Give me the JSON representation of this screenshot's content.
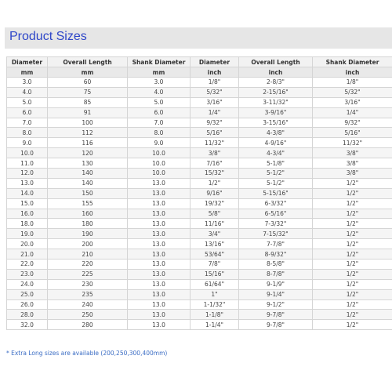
{
  "page": {
    "title": "Product Sizes"
  },
  "table": {
    "headers": [
      "Diameter",
      "Overall Length",
      "Shank Diameter",
      "Diameter",
      "Overall Length",
      "Shank Diameter"
    ],
    "units": [
      "mm",
      "mm",
      "mm",
      "inch",
      "inch",
      "inch"
    ],
    "rows": [
      [
        "3.0",
        "60",
        "3.0",
        "1/8\"",
        "2-8/3\"",
        "1/8\""
      ],
      [
        "4.0",
        "75",
        "4.0",
        "5/32\"",
        "2-15/16\"",
        "5/32\""
      ],
      [
        "5.0",
        "85",
        "5.0",
        "3/16\"",
        "3-11/32\"",
        "3/16\""
      ],
      [
        "6.0",
        "91",
        "6.0",
        "1/4\"",
        "3-9/16\"",
        "1/4\""
      ],
      [
        "7.0",
        "100",
        "7.0",
        "9/32\"",
        "3-15/16\"",
        "9/32\""
      ],
      [
        "8.0",
        "112",
        "8.0",
        "5/16\"",
        "4-3/8\"",
        "5/16\""
      ],
      [
        "9.0",
        "116",
        "9.0",
        "11/32\"",
        "4-9/16\"",
        "11/32\""
      ],
      [
        "10.0",
        "120",
        "10.0",
        "3/8\"",
        "4-3/4\"",
        "3/8\""
      ],
      [
        "11.0",
        "130",
        "10.0",
        "7/16\"",
        "5-1/8\"",
        "3/8\""
      ],
      [
        "12.0",
        "140",
        "10.0",
        "15/32\"",
        "5-1/2\"",
        "3/8\""
      ],
      [
        "13.0",
        "140",
        "13.0",
        "1/2\"",
        "5-1/2\"",
        "1/2\""
      ],
      [
        "14.0",
        "150",
        "13.0",
        "9/16\"",
        "5-15/16\"",
        "1/2\""
      ],
      [
        "15.0",
        "155",
        "13.0",
        "19/32\"",
        "6-3/32\"",
        "1/2\""
      ],
      [
        "16.0",
        "160",
        "13.0",
        "5/8\"",
        "6-5/16\"",
        "1/2\""
      ],
      [
        "18.0",
        "180",
        "13.0",
        "11/16\"",
        "7-3/32\"",
        "1/2\""
      ],
      [
        "19.0",
        "190",
        "13.0",
        "3/4\"",
        "7-15/32\"",
        "1/2\""
      ],
      [
        "20.0",
        "200",
        "13.0",
        "13/16\"",
        "7-7/8\"",
        "1/2\""
      ],
      [
        "21.0",
        "210",
        "13.0",
        "53/64\"",
        "8-9/32\"",
        "1/2\""
      ],
      [
        "22.0",
        "220",
        "13.0",
        "7/8\"",
        "8-5/8\"",
        "1/2\""
      ],
      [
        "23.0",
        "225",
        "13.0",
        "15/16\"",
        "8-7/8\"",
        "1/2\""
      ],
      [
        "24.0",
        "230",
        "13.0",
        "61/64\"",
        "9-1/9\"",
        "1/2\""
      ],
      [
        "25.0",
        "235",
        "13.0",
        "1\"",
        "9-1/4\"",
        "1/2\""
      ],
      [
        "26.0",
        "240",
        "13.0",
        "1-1/32\"",
        "9-1/2\"",
        "1/2\""
      ],
      [
        "28.0",
        "250",
        "13.0",
        "1-1/8\"",
        "9-7/8\"",
        "1/2\""
      ],
      [
        "32.0",
        "280",
        "13.0",
        "1-1/4\"",
        "9-7/8\"",
        "1/2\""
      ]
    ]
  },
  "footnote": "* Extra Long sizes are available (200,250,300,400mm)"
}
